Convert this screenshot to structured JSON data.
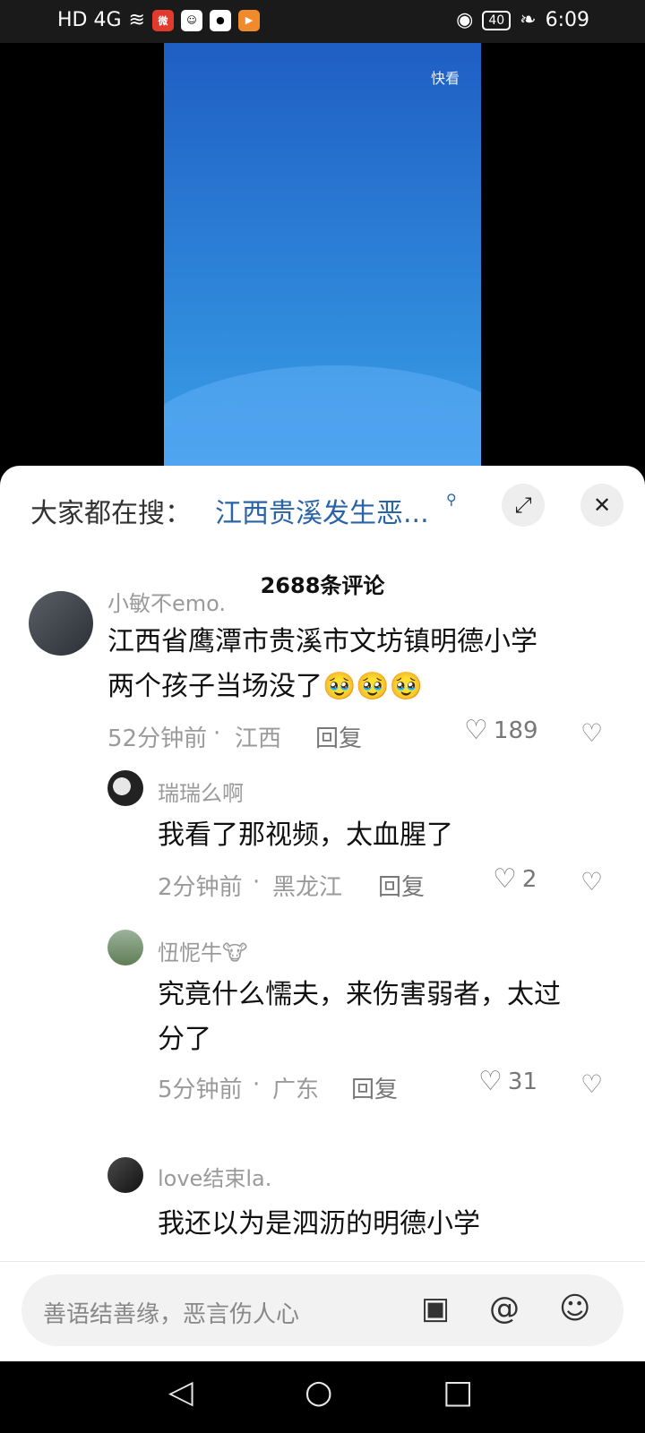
{
  "status_bar": {
    "network": "HD 4G",
    "battery": "40",
    "time": "6:09"
  },
  "video": {
    "watermark": "快看"
  },
  "search": {
    "prefix": "大家都在搜：",
    "query": "江西贵溪发生恶..."
  },
  "comments_header": {
    "count": "2688条评论"
  },
  "comments": [
    {
      "user": "小敏不emo.",
      "text_line1": "江西省鹰潭市贵溪市文坊镇明德小学",
      "text_line2": "两个孩子当场没了🥹🥹🥹",
      "time": "52分钟前",
      "location": "江西",
      "reply": "回复",
      "likes": "189"
    },
    {
      "user": "瑞瑞么啊",
      "text_line1": "我看了那视频，太血腥了",
      "time": "2分钟前",
      "location": "黑龙江",
      "reply": "回复",
      "likes": "2"
    },
    {
      "user": "忸怩牛🐮",
      "text_line1": "究竟什么懦夫，来伤害弱者，太过",
      "text_line2": "分了",
      "time": "5分钟前",
      "location": "广东",
      "reply": "回复",
      "likes": "31"
    },
    {
      "user": "love结束la.",
      "text_line1": "我还以为是泗沥的明德小学"
    }
  ],
  "input": {
    "placeholder": "善语结善缘，恶言伤人心"
  }
}
